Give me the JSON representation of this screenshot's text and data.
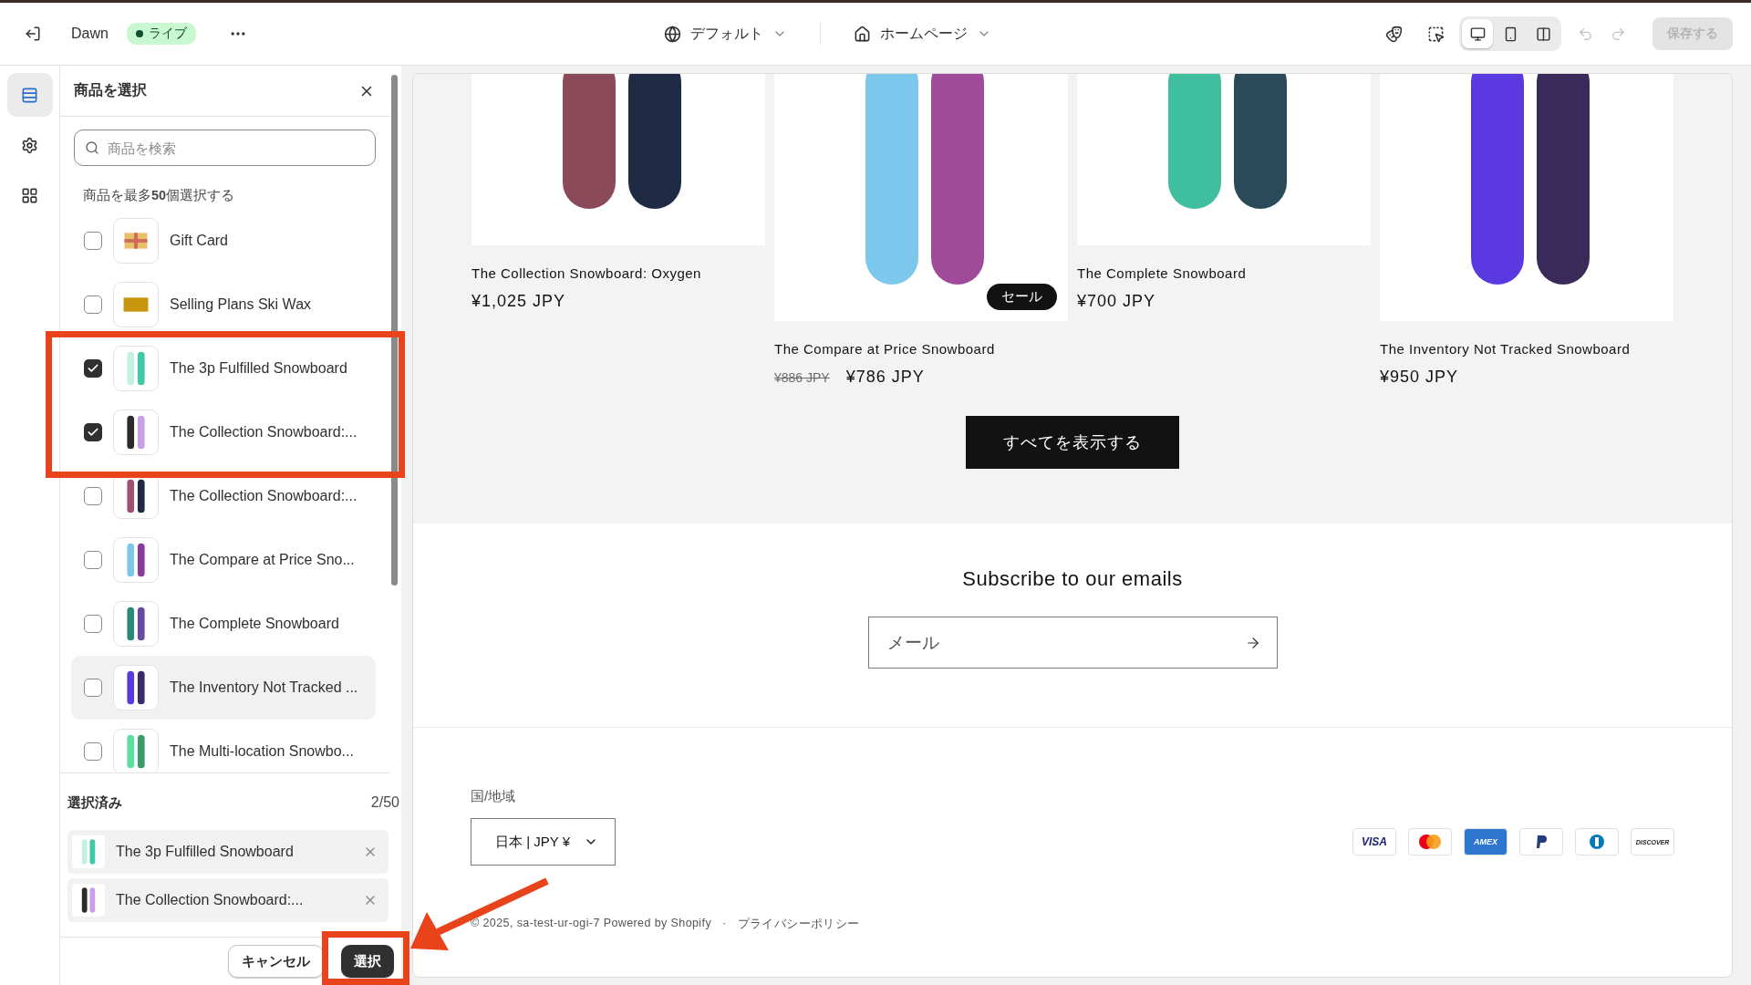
{
  "topbar": {
    "theme": "Dawn",
    "status": "ライブ",
    "template": "デフォルト",
    "page": "ホームページ",
    "view_modes": [
      {
        "kind": "desktop",
        "selected": true
      },
      {
        "kind": "mobile",
        "selected": false
      },
      {
        "kind": "fullwidth",
        "selected": false
      }
    ],
    "undo_disabled": true,
    "redo_disabled": true,
    "save": {
      "label": "保存する",
      "disabled": true
    }
  },
  "rail": [
    {
      "kind": "sections",
      "selected": true
    },
    {
      "kind": "settings",
      "selected": false
    },
    {
      "kind": "apps",
      "selected": false
    }
  ],
  "picker": {
    "title": "商品を選択",
    "search_placeholder": "商品を検索",
    "hint": "商品を最多**50**個選択する",
    "products": [
      {
        "name": "Gift Card",
        "kind": "gift",
        "checked": false,
        "highlighted": false
      },
      {
        "name": "Selling Plans Ski Wax",
        "kind": "wax",
        "checked": false,
        "highlighted": false
      },
      {
        "name": "The 3p Fulfilled Snowboard",
        "kind": "snowboard",
        "checked": true,
        "highlighted": false
      },
      {
        "name": "The Collection Snowboard:...",
        "kind": "snowboard",
        "checked": true,
        "highlighted": false
      },
      {
        "name": "The Collection Snowboard:...",
        "kind": "snowboard",
        "checked": false,
        "highlighted": false
      },
      {
        "name": "The Compare at Price Sno...",
        "kind": "snowboard",
        "checked": false,
        "highlighted": false
      },
      {
        "name": "The Complete Snowboard",
        "kind": "snowboard",
        "checked": false,
        "highlighted": false
      },
      {
        "name": "The Inventory Not Tracked ...",
        "kind": "snowboard",
        "checked": false,
        "highlighted": true
      },
      {
        "name": "The Multi-location Snowbo...",
        "kind": "snowboard",
        "checked": false,
        "highlighted": false
      }
    ],
    "selected_title": "選択済み",
    "selected_count": "2/50",
    "selected": [
      {
        "name": "The 3p Fulfilled Snowboard"
      },
      {
        "name": "The Collection Snowboard:..."
      }
    ],
    "cancel": "キャンセル",
    "confirm": "選択"
  },
  "preview": {
    "products": [
      {
        "name": "The Collection Snowboard: Oxygen",
        "price": "¥1,025 JPY"
      },
      {
        "name": "The Compare at Price Snowboard",
        "compare_price": "¥886 JPY",
        "price": "¥786 JPY",
        "badge": "セール"
      },
      {
        "name": "The Complete Snowboard",
        "price": "¥700 JPY"
      },
      {
        "name": "The Inventory Not Tracked Snowboard",
        "price": "¥950 JPY"
      }
    ],
    "view_all": "すべてを表示する",
    "subscribe_title": "Subscribe to our emails",
    "email_placeholder": "メール",
    "country_label": "国/地域",
    "country": "日本 | JPY ¥",
    "payments": [
      {
        "kind": "visa",
        "label": "VISA"
      },
      {
        "kind": "mastercard"
      },
      {
        "kind": "amex",
        "label": "AMEX"
      },
      {
        "kind": "paypal"
      },
      {
        "kind": "diners"
      },
      {
        "kind": "discover",
        "label": "DISCOVER"
      }
    ],
    "copyright": "© 2025, sa-test-ur-ogi-7 Powered by Shopify",
    "separator": "·",
    "privacy": "プライバシーポリシー"
  }
}
